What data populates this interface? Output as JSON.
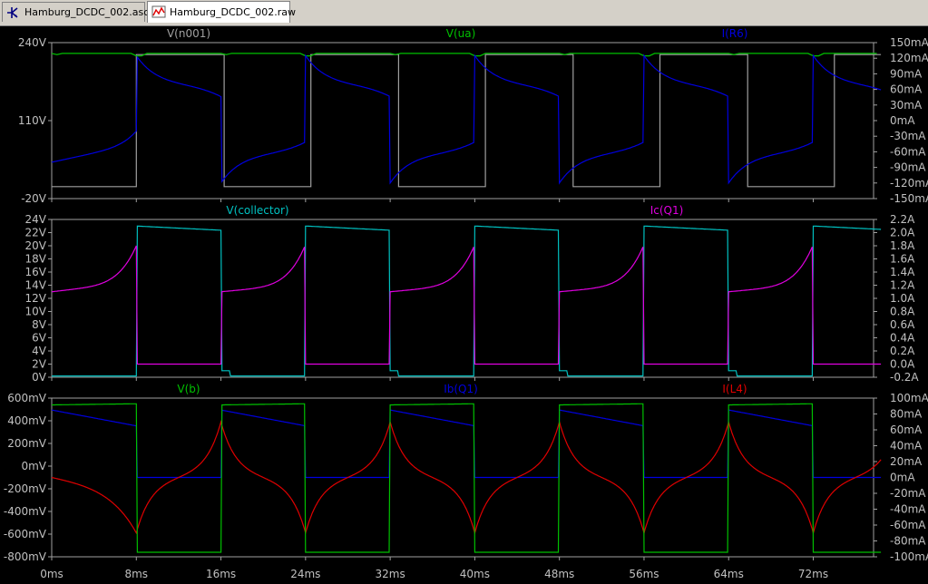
{
  "tabs": [
    {
      "label": "Hamburg_DCDC_002.asc",
      "icon": "schematic-icon",
      "active": false
    },
    {
      "label": "Hamburg_DCDC_002.raw",
      "icon": "waveform-icon",
      "active": true
    }
  ],
  "colors": {
    "gray": "#a0a0a0",
    "green": "#00c000",
    "blue": "#0000e0",
    "cyan": "#00c0c0",
    "magenta": "#e000e0",
    "red": "#e00000",
    "frame": "#a0a0a0",
    "text": "#c0c0c0"
  },
  "x_axis": {
    "ticks": [
      "0ms",
      "8ms",
      "16ms",
      "24ms",
      "32ms",
      "40ms",
      "48ms",
      "56ms",
      "64ms",
      "72ms"
    ]
  },
  "chart_data": [
    {
      "type": "line",
      "pane": "top",
      "traces": [
        {
          "name": "V(n001)",
          "color": "#a0a0a0"
        },
        {
          "name": "V(ua)",
          "color": "#00c000"
        },
        {
          "name": "I(R6)",
          "color": "#0000e0"
        }
      ],
      "left_ticks": [
        "240V",
        "110V",
        "-20V"
      ],
      "right_ticks": [
        "150mA",
        "120mA",
        "90mA",
        "60mA",
        "30mA",
        "0mA",
        "-30mA",
        "-60mA",
        "-90mA",
        "-120mA",
        "-150mA"
      ],
      "left_ylim": [
        -20,
        240
      ],
      "right_ylim": [
        -150,
        150
      ],
      "period_ms": 16,
      "series": [
        {
          "name": "V(n001)",
          "levels_V": [
            220,
            0
          ]
        },
        {
          "name": "V(ua)",
          "level_V": 222
        },
        {
          "name": "I(R6)",
          "range_mA": [
            -120,
            125
          ]
        }
      ]
    },
    {
      "type": "line",
      "pane": "middle",
      "traces": [
        {
          "name": "V(collector)",
          "color": "#00c0c0"
        },
        {
          "name": "Ic(Q1)",
          "color": "#e000e0"
        }
      ],
      "left_ticks": [
        "24V",
        "22V",
        "20V",
        "18V",
        "16V",
        "14V",
        "12V",
        "10V",
        "8V",
        "6V",
        "4V",
        "2V",
        "0V"
      ],
      "right_ticks": [
        "2.2A",
        "2.0A",
        "1.8A",
        "1.6A",
        "1.4A",
        "1.2A",
        "1.0A",
        "0.8A",
        "0.6A",
        "0.4A",
        "0.2A",
        "0.0A",
        "-0.2A"
      ],
      "left_ylim": [
        0,
        24
      ],
      "right_ylim": [
        -0.2,
        2.2
      ],
      "series": [
        {
          "name": "V(collector)",
          "levels_V": [
            23,
            0.2
          ]
        },
        {
          "name": "Ic(Q1)",
          "range_A": [
            0,
            2.0
          ]
        }
      ]
    },
    {
      "type": "line",
      "pane": "bottom",
      "traces": [
        {
          "name": "V(b)",
          "color": "#00c000"
        },
        {
          "name": "Ib(Q1)",
          "color": "#0000e0"
        },
        {
          "name": "I(L4)",
          "color": "#e00000"
        }
      ],
      "left_ticks": [
        "600mV",
        "400mV",
        "200mV",
        "0mV",
        "-200mV",
        "-400mV",
        "-600mV",
        "-800mV"
      ],
      "right_ticks": [
        "100mA",
        "80mA",
        "60mA",
        "40mA",
        "20mA",
        "0mA",
        "-20mA",
        "-40mA",
        "-60mA",
        "-80mA",
        "-100mA"
      ],
      "left_ylim": [
        -800,
        600
      ],
      "right_ylim": [
        -100,
        100
      ],
      "series": [
        {
          "name": "V(b)",
          "levels_mV": [
            540,
            -760
          ]
        },
        {
          "name": "Ib(Q1)",
          "range_mA": [
            0,
            85
          ]
        },
        {
          "name": "I(L4)",
          "range_mA": [
            -90,
            90
          ]
        }
      ]
    }
  ]
}
